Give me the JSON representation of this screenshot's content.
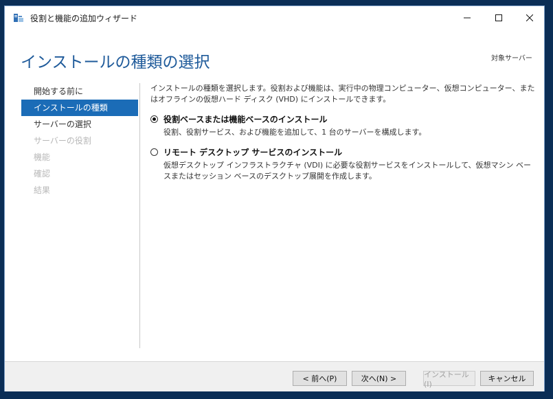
{
  "window": {
    "title": "役割と機能の追加ウィザード"
  },
  "header": {
    "page_title": "インストールの種類の選択",
    "target_server": "対象サーバー"
  },
  "nav": {
    "items": [
      {
        "label": "開始する前に",
        "state": "normal"
      },
      {
        "label": "インストールの種類",
        "state": "active"
      },
      {
        "label": "サーバーの選択",
        "state": "normal"
      },
      {
        "label": "サーバーの役割",
        "state": "disabled"
      },
      {
        "label": "機能",
        "state": "disabled"
      },
      {
        "label": "確認",
        "state": "disabled"
      },
      {
        "label": "結果",
        "state": "disabled"
      }
    ]
  },
  "content": {
    "description": "インストールの種類を選択します。役割および機能は、実行中の物理コンピューター、仮想コンピューター、またはオフラインの仮想ハード ディスク (VHD) にインストールできます。",
    "options": [
      {
        "title": "役割ベースまたは機能ベースのインストール",
        "description": "役割、役割サービス、および機能を追加して、1 台のサーバーを構成します。",
        "selected": true
      },
      {
        "title": "リモート デスクトップ サービスのインストール",
        "description": "仮想デスクトップ インフラストラクチャ (VDI) に必要な役割サービスをインストールして、仮想マシン ベースまたはセッション ベースのデスクトップ展開を作成します。",
        "selected": false
      }
    ]
  },
  "footer": {
    "prev_label": "< 前へ(P)",
    "next_label": "次へ(N) >",
    "install_label": "インストール(I)",
    "cancel_label": "キャンセル"
  },
  "colors": {
    "accent": "#1b6cb7",
    "title": "#1e5a9a",
    "desktop": "#0b2e56"
  }
}
